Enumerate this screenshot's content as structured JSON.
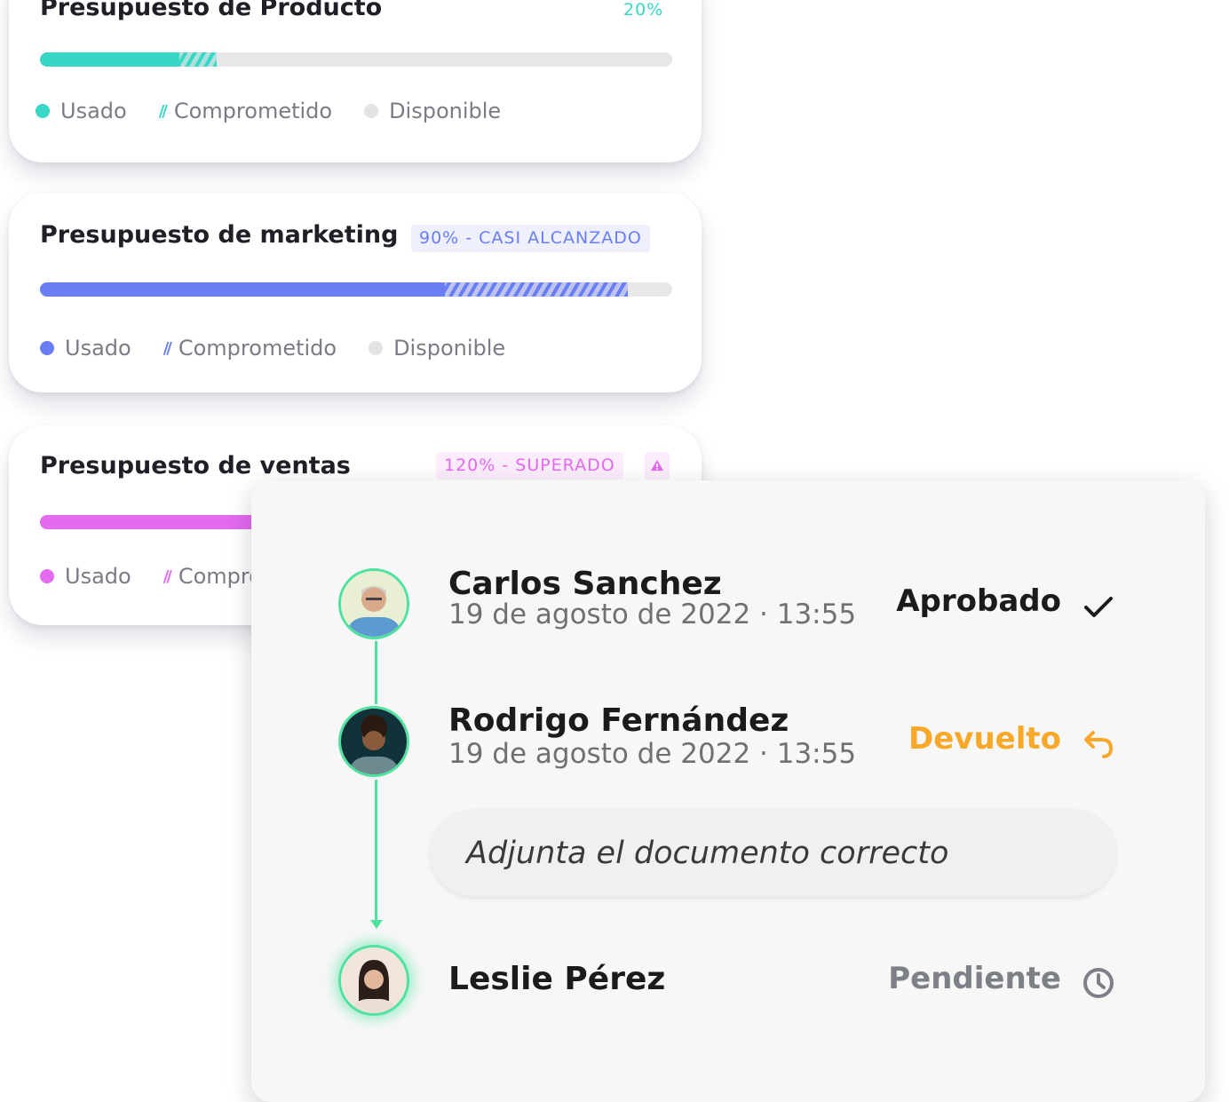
{
  "legend": {
    "used_label": "Usado",
    "committed_label": "Comprometido",
    "available_label": "Disponible"
  },
  "budgets": [
    {
      "title": "Presupuesto de Producto",
      "badge": "20%",
      "accent_color": "#38d6c5",
      "badge_bg": "#e9fbf8",
      "used_fraction": 0.22,
      "committed_fraction": 0.28
    },
    {
      "title": "Presupuesto de marketing",
      "badge": "90% - CASI ALCANZADO",
      "accent_color": "#6a7ef3",
      "badge_bg": "#eef0fd",
      "used_fraction": 0.64,
      "committed_fraction": 0.93
    },
    {
      "title": "Presupuesto de ventas",
      "badge": "120% - SUPERADO",
      "accent_color": "#e46af0",
      "badge_bg": "#fcedfd",
      "alert_icon": "warning-triangle-icon",
      "used_fraction": 0.72,
      "committed_fraction": 0.9
    }
  ],
  "approval": {
    "steps": [
      {
        "name": "Carlos Sanchez",
        "date": "19 de agosto de 2022 · 13:55",
        "status": "Aprobado",
        "status_color": "#1b1b1b",
        "status_icon": "check-icon"
      },
      {
        "name": "Rodrigo Fernández",
        "date": "19 de agosto de 2022 · 13:55",
        "status": "Devuelto",
        "status_color": "#f7a829",
        "status_icon": "return-arrow-icon"
      },
      {
        "name": "Leslie Pérez",
        "status": "Pendiente",
        "status_color": "#7d8087",
        "status_icon": "clock-icon"
      }
    ],
    "comment": "Adjunta el documento correcto",
    "timeline_color": "#4fe19f"
  }
}
